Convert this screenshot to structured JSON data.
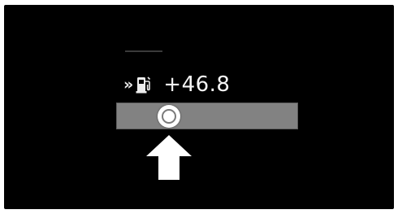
{
  "display": {
    "chevron_symbol": "»",
    "fuel_icon": "fuel-pump-icon",
    "value_text": "+46.8"
  },
  "slider": {
    "position_fraction": 0.29,
    "track_color": "#828282",
    "knob_color": "#ffffff"
  },
  "pointer": {
    "icon": "up-arrow-icon",
    "color": "#ffffff"
  }
}
